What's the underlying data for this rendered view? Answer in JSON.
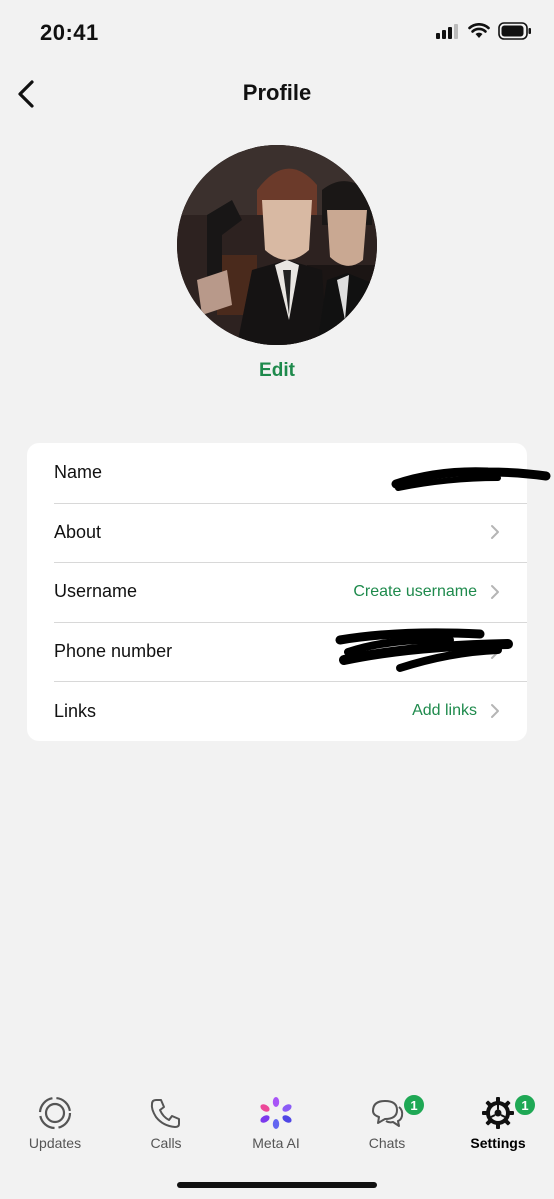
{
  "status_bar": {
    "time": "20:41",
    "icons": [
      "signal-icon",
      "wifi-icon",
      "battery-icon"
    ]
  },
  "nav": {
    "title": "Profile",
    "back_icon": "chevron-left-icon"
  },
  "profile": {
    "edit_label": "Edit"
  },
  "rows": [
    {
      "label": "Name",
      "value": "",
      "redacted": true
    },
    {
      "label": "About",
      "value": ""
    },
    {
      "label": "Username",
      "value": "Create username"
    },
    {
      "label": "Phone number",
      "value": "",
      "redacted": true
    },
    {
      "label": "Links",
      "value": "Add links"
    }
  ],
  "tabs": [
    {
      "label": "Updates",
      "icon": "updates-icon"
    },
    {
      "label": "Calls",
      "icon": "phone-icon"
    },
    {
      "label": "Meta AI",
      "icon": "meta-ai-icon"
    },
    {
      "label": "Chats",
      "icon": "chat-bubbles-icon",
      "badge": "1"
    },
    {
      "label": "Settings",
      "icon": "gear-icon",
      "badge": "1",
      "active": true
    }
  ],
  "colors": {
    "accent": "#1e8a4c",
    "badge": "#1fa855",
    "background": "#f2f2f2",
    "card": "#ffffff"
  }
}
